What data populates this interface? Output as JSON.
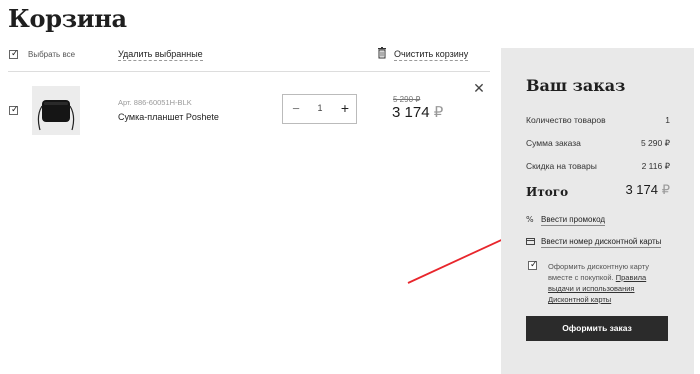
{
  "page": {
    "title": "Корзина"
  },
  "toolbar": {
    "select_all": "Выбрать все",
    "delete_selected": "Удалить выбранные",
    "clear_cart": "Очистить корзину"
  },
  "item": {
    "article": "Арт. 886-60051Н-BLK",
    "name": "Сумка-планшет Poshete",
    "quantity": "1",
    "old_price": "5 290 ₽",
    "price": "3 174",
    "currency": "₽"
  },
  "order": {
    "title": "Ваш заказ",
    "rows": [
      {
        "label": "Количество товаров",
        "value": "1"
      },
      {
        "label": "Сумма заказа",
        "value": "5 290 ₽"
      },
      {
        "label": "Скидка на товары",
        "value": "2 116 ₽"
      }
    ],
    "total_label": "Итого",
    "total_value": "3 174",
    "currency": "₽",
    "promo_link": "Ввести промокод",
    "card_link": "Ввести номер дисконтной карты",
    "agree_text_1": "Оформить дисконтную карту вместе с покупкой.",
    "agree_link": "Правила выдачи и использования Дисконтной карты",
    "submit": "Оформить заказ"
  },
  "colors": {
    "accent_arrow": "#e8262c",
    "button": "#2b2b2b",
    "sidebar_bg": "#e9e9e9"
  }
}
